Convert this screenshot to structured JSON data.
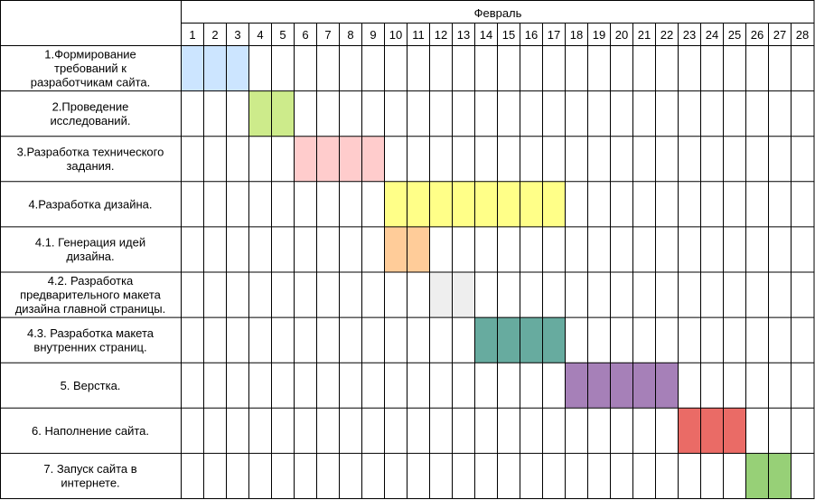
{
  "month": "Февраль",
  "days": [
    "1",
    "2",
    "3",
    "4",
    "5",
    "6",
    "7",
    "8",
    "9",
    "10",
    "11",
    "12",
    "13",
    "14",
    "15",
    "16",
    "17",
    "18",
    "19",
    "20",
    "21",
    "22",
    "23",
    "24",
    "25",
    "26",
    "27",
    "28"
  ],
  "tasks": [
    {
      "label": [
        "1.Формирование",
        "требований к",
        "разработчикам сайта."
      ],
      "start": 1,
      "end": 3,
      "color": "#cce5ff"
    },
    {
      "label": [
        "2.Проведение",
        "исследований."
      ],
      "start": 4,
      "end": 5,
      "color": "#cdeb8b"
    },
    {
      "label": [
        "3.Разработка технического",
        "задания."
      ],
      "start": 6,
      "end": 9,
      "color": "#ffcccc"
    },
    {
      "label": [
        "4.Разработка дизайна."
      ],
      "start": 10,
      "end": 17,
      "color": "#ffff88"
    },
    {
      "label": [
        "4.1. Генерация идей",
        "дизайна."
      ],
      "start": 10,
      "end": 11,
      "color": "#ffcc99"
    },
    {
      "label": [
        "4.2. Разработка",
        "предварительного макета",
        "дизайна главной страницы."
      ],
      "start": 12,
      "end": 13,
      "color": "#eeeeee"
    },
    {
      "label": [
        "4.3. Разработка макета",
        "внутренних страниц."
      ],
      "start": 14,
      "end": 17,
      "color": "#67ab9f"
    },
    {
      "label": [
        "5. Верстка."
      ],
      "start": 18,
      "end": 22,
      "color": "#a680b8"
    },
    {
      "label": [
        "6. Наполнение сайта."
      ],
      "start": 23,
      "end": 25,
      "color": "#ea6b66"
    },
    {
      "label": [
        "7. Запуск сайта в",
        "интернете."
      ],
      "start": 26,
      "end": 27,
      "color": "#97d077"
    }
  ]
}
